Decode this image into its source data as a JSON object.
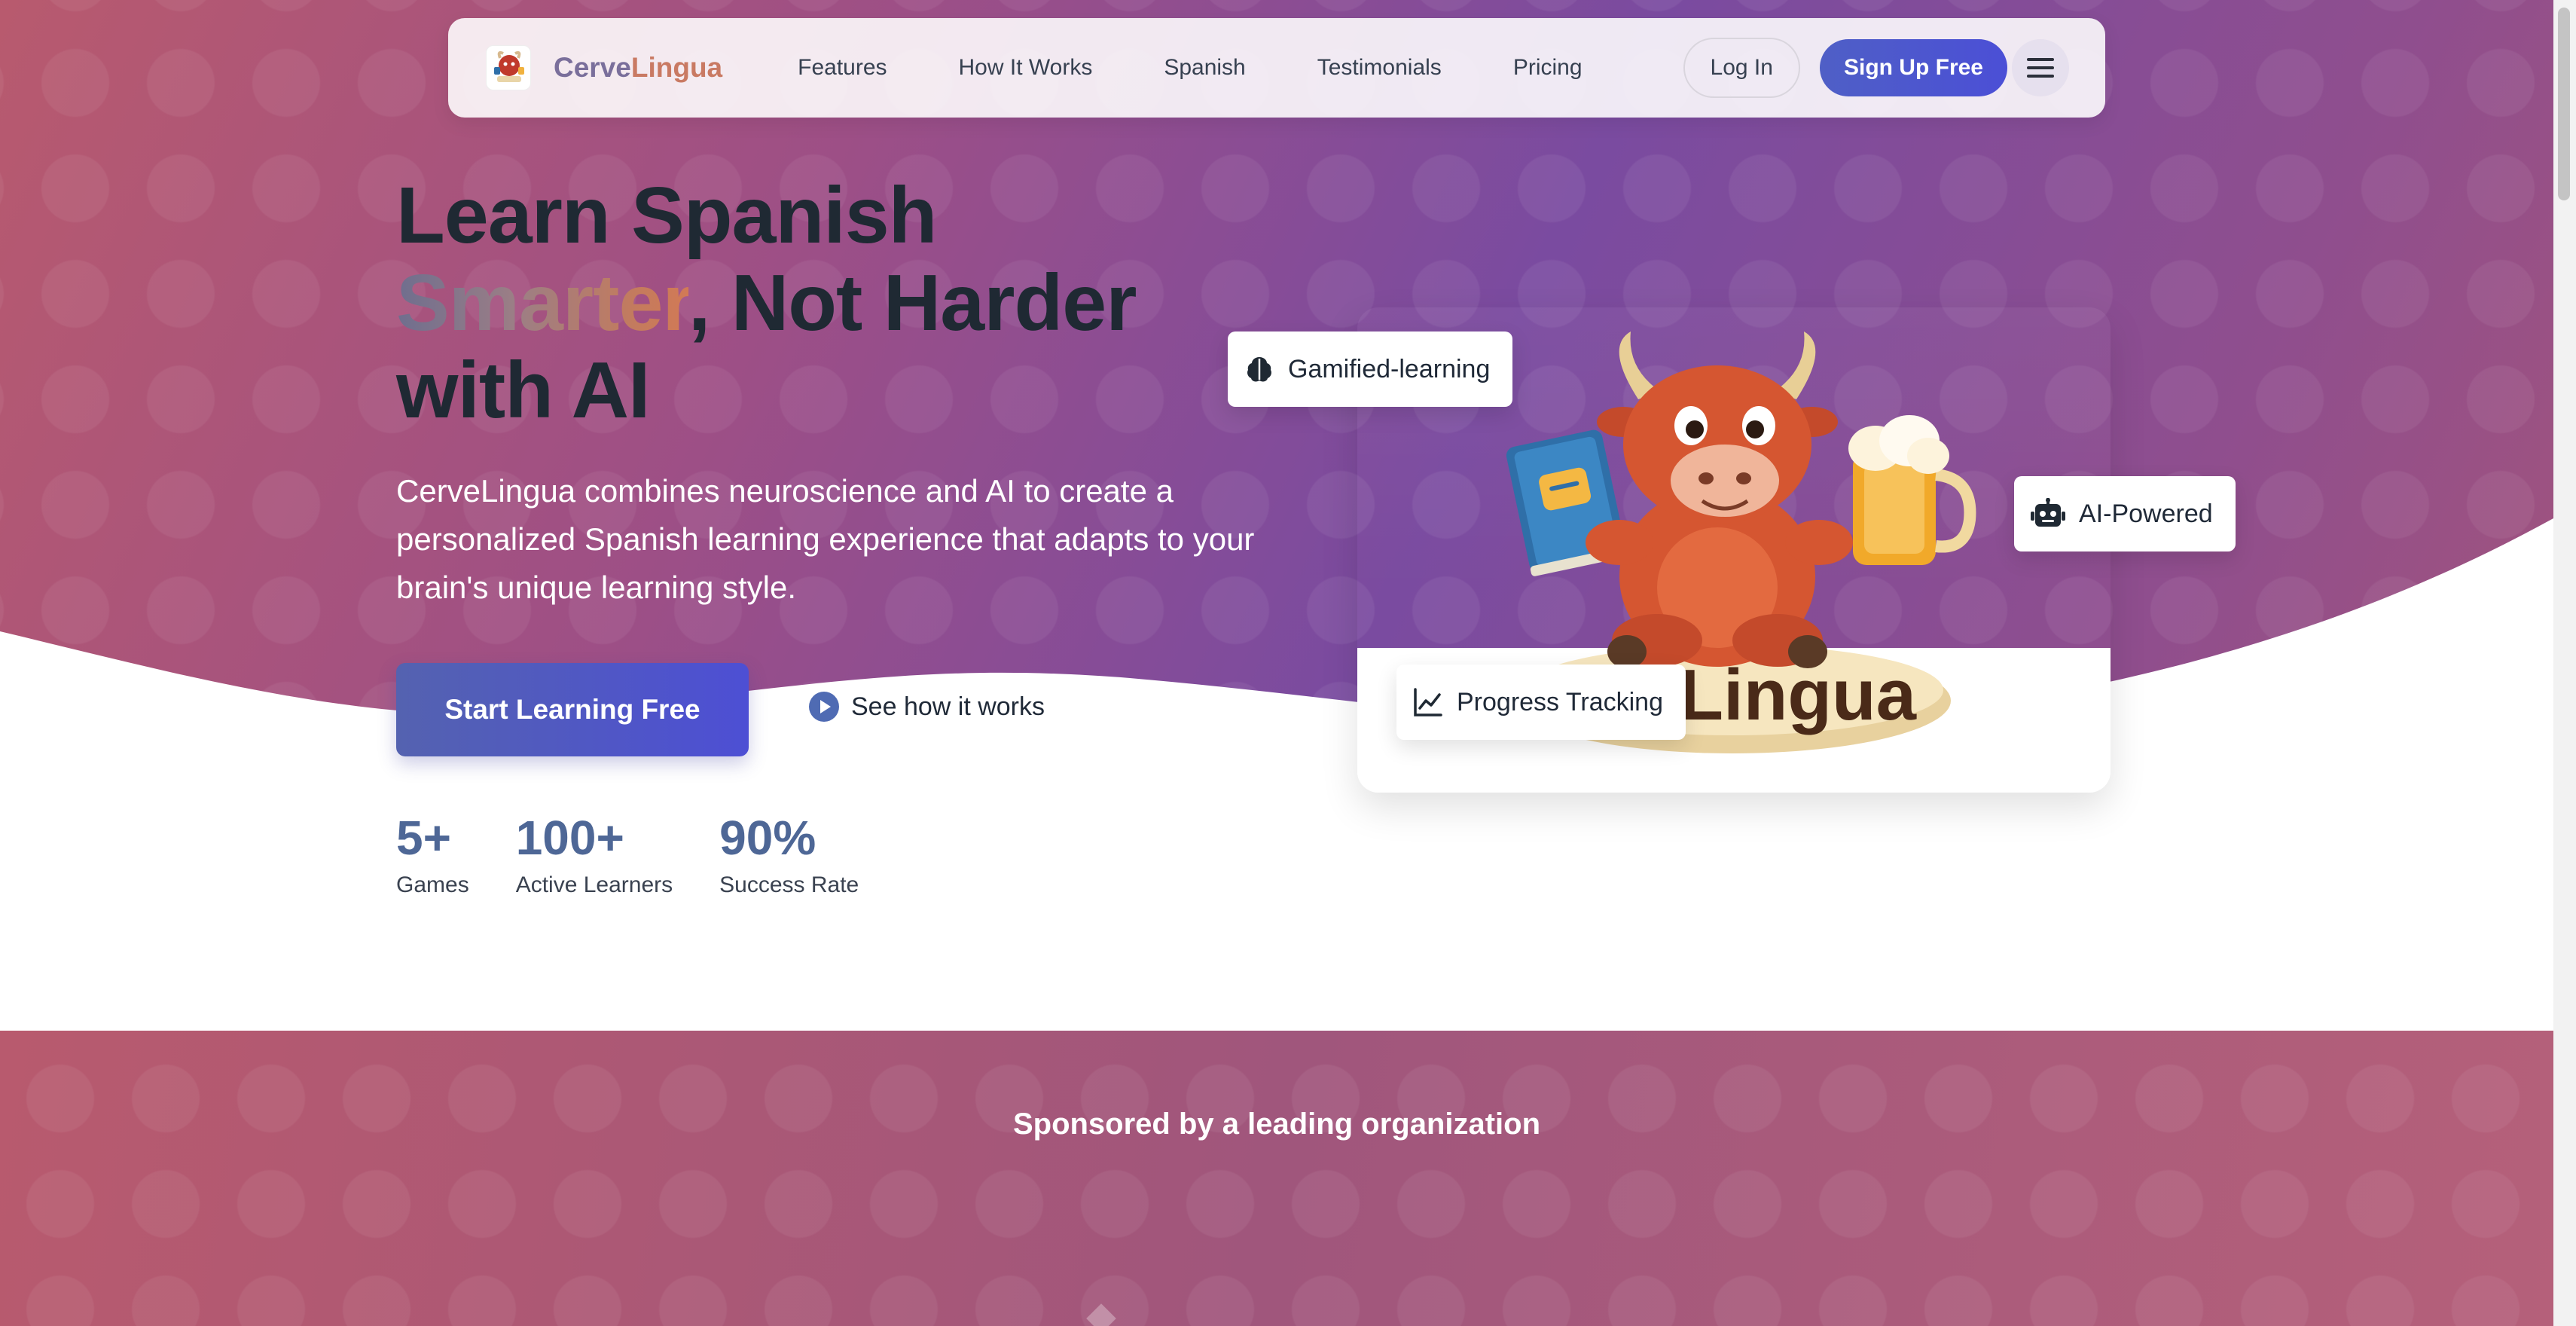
{
  "brand": {
    "name_part1": "Cerve",
    "name_part2": "Lingua",
    "logo_alt": "CerveLingua logo"
  },
  "nav": {
    "links": [
      "Features",
      "How It Works",
      "Spanish",
      "Testimonials",
      "Pricing"
    ],
    "login_label": "Log In",
    "signup_label": "Sign Up Free",
    "menu_icon": "hamburger-menu-icon"
  },
  "hero": {
    "headline_line1": "Learn Spanish",
    "headline_highlight": "Smarter",
    "headline_line2_rest": ", Not Harder",
    "headline_line3": "with AI",
    "subtext": "CerveLingua combines neuroscience and AI to create a personalized Spanish learning experience that adapts to your brain's unique learning style.",
    "cta_primary": "Start Learning Free",
    "cta_secondary": "See how it works",
    "stats": [
      {
        "value": "5+",
        "label": "Games"
      },
      {
        "value": "100+",
        "label": "Active Learners"
      },
      {
        "value": "90%",
        "label": "Success Rate"
      }
    ],
    "chips": {
      "gamified": "Gamified-learning",
      "ai": "AI-Powered",
      "progress": "Progress Tracking"
    },
    "mascot_banner_text": "eLingua"
  },
  "sponsor": {
    "title": "Sponsored by a leading organization"
  },
  "colors": {
    "primary": "#4b4fd6",
    "stat_color": "#4e6796",
    "headline": "#1f2933",
    "brand_purple": "#7a6f9b",
    "brand_orange": "#c97a63"
  }
}
